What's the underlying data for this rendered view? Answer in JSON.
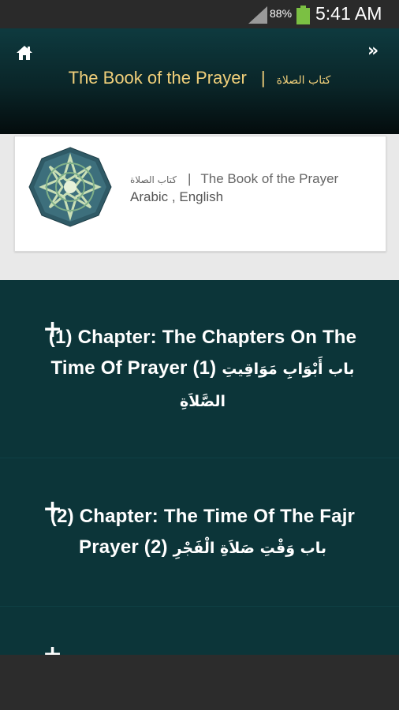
{
  "status_bar": {
    "battery_percent": "88%",
    "time": "5:41 AM",
    "icons": [
      "signal-icon",
      "battery-icon"
    ]
  },
  "app_bar": {
    "title_en": "The Book of the Prayer",
    "separator": "|",
    "title_ar": "كتاب الصلاة",
    "home_icon": "home-icon",
    "menu_icon": "double-chevron-right-icon",
    "menu_glyph": "»"
  },
  "book": {
    "title_ar": "كتاب الصلاة",
    "separator": "|",
    "title_en": "The Book of the Prayer",
    "languages": "Arabic , English",
    "logo_icon": "islamic-star-pattern-logo"
  },
  "chapters": [
    {
      "expand_glyph": "+",
      "text_en": "(1) Chapter: The Chapters On The Time Of Prayer (1)",
      "text_ar": "باب أَبْوَابِ مَوَاقِيتِ الصَّلاَةِ"
    },
    {
      "expand_glyph": "+",
      "text_en": "(2) Chapter: The Time Of The Fajr Prayer (2)",
      "text_ar": "باب وَقْتِ صَلاَةِ الْفَجْرِ"
    },
    {
      "expand_glyph": "+",
      "text_en": "",
      "text_ar": ""
    }
  ],
  "colors": {
    "header_gold": "#f0cf7a",
    "chapters_background": "#0c3539",
    "battery_green": "#7bc043"
  }
}
